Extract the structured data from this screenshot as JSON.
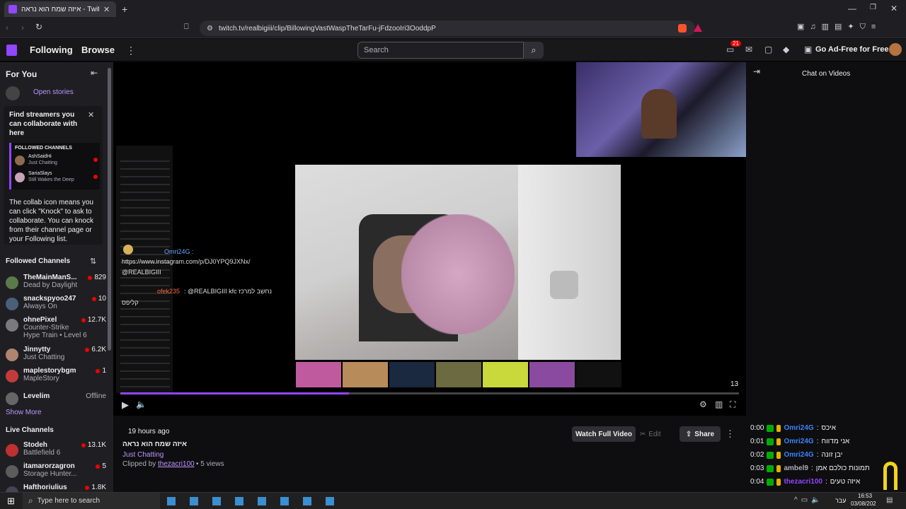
{
  "browser": {
    "tab_title": "איזה שמח הוא נראה - Twitch",
    "url": "twitch.tv/realbigiii/clip/BillowingVastWaspTheTarFu-jFdzooIri3OoddpP"
  },
  "header": {
    "following": "Following",
    "browse": "Browse",
    "search_placeholder": "Search",
    "notif_count": "21",
    "go_ad_free": "Go Ad-Free for Free"
  },
  "sidebar": {
    "for_you": "For You",
    "open_stories": "Open stories",
    "collab_title": "Find streamers you can collaborate with here",
    "followed_channels_small": "FOLLOWED CHANNELS",
    "collab_examples": [
      {
        "name": "AshSaidHi",
        "game": "Just Chatting"
      },
      {
        "name": "SariaSlays",
        "game": "Still Wakes the Deep"
      }
    ],
    "collab_body": "The collab icon means you can click \"Knock\" to ask to collaborate. You can knock from their channel page or your Following list.",
    "followed_title": "Followed Channels",
    "followed": [
      {
        "name": "TheMainManS...",
        "game": "Dead by Daylight",
        "viewers": "829"
      },
      {
        "name": "snackspyoo247",
        "game": "Always On",
        "viewers": "10"
      },
      {
        "name": "ohnePixel",
        "game": "Counter-Strike",
        "viewers": "12.7K",
        "extra": "Hype Train • Level 6"
      },
      {
        "name": "Jinnytty",
        "game": "Just Chatting",
        "viewers": "6.2K"
      },
      {
        "name": "maplestorybgm",
        "game": "MapleStory",
        "viewers": "1"
      },
      {
        "name": "Levelim",
        "game": "",
        "viewers": "Offline"
      }
    ],
    "show_more": "Show More",
    "live_title": "Live Channels",
    "live": [
      {
        "name": "Stodeh",
        "game": "Battlefield 6",
        "viewers": "13.1K"
      },
      {
        "name": "itamarorzagron",
        "game": "Storage Hunter...",
        "viewers": "5"
      },
      {
        "name": "Hafthoriulius",
        "game": "",
        "viewers": "1.8K"
      }
    ]
  },
  "player": {
    "overlay_user1": "Omri24G :",
    "overlay_link": "https://www.instagram.com/p/DJ0YPQ9JXNx/",
    "overlay_tag": "@REALBIGIII",
    "overlay_user2": "ofek235",
    "overlay_msg2": ": @REALBIGIII kfc נחשב למרכז",
    "overlay_word": "קליפס",
    "counter": "13"
  },
  "clip": {
    "time_ago": "19 hours ago",
    "title": "איזה שמח הוא נראה",
    "category": "Just Chatting",
    "clipped_by_label": "Clipped by",
    "clipped_by": "thezacri100",
    "views": "• 5 views",
    "watch_full": "Watch Full Video",
    "edit": "Edit",
    "share": "Share"
  },
  "chat": {
    "title": "Chat on Videos",
    "lines": [
      {
        "t": "0:00",
        "user": "Omri24G",
        "color": "#3b82f6",
        "msg": "איכס"
      },
      {
        "t": "0:01",
        "user": "Omri24G",
        "color": "#3b82f6",
        "msg": "אני מדווח"
      },
      {
        "t": "0:02",
        "user": "Omri24G",
        "color": "#3b82f6",
        "msg": "יבן זונה"
      },
      {
        "t": "0:03",
        "user": "ambel9",
        "color": "#adadb8",
        "msg": "תמונות כולכם אמן"
      },
      {
        "t": "0:04",
        "user": "thezacri100",
        "color": "#9146ff",
        "msg": "איזה טעים"
      }
    ]
  },
  "taskbar": {
    "search": "Type here to search",
    "time": "16:53",
    "date": "03/08/202",
    "lang": "עבר"
  },
  "colors": {
    "brand": "#9146ff",
    "live": "#eb0400"
  }
}
